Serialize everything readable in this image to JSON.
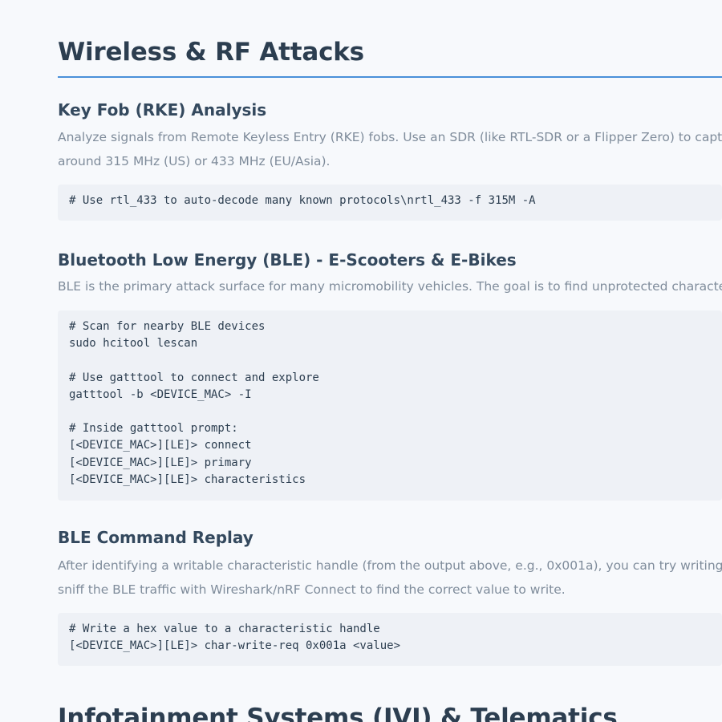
{
  "section": {
    "title": "Wireless & RF Attacks"
  },
  "rke": {
    "title": "Key Fob (RKE) Analysis",
    "line1": "Analyze signals from Remote Keyless Entry (RKE) fobs. Use an SDR (like RTL-SDR or a Flipper Zero) to capture t",
    "line2": "around 315 MHz (US) or 433 MHz (EU/Asia).",
    "code": "# Use rtl_433 to auto-decode many known protocols\\nrtl_433 -f 315M -A"
  },
  "ble": {
    "title": "Bluetooth Low Energy (BLE) - E-Scooters & E-Bikes",
    "line1": "BLE is the primary attack surface for many micromobility vehicles. The goal is to find unprotected characterist",
    "code": "# Scan for nearby BLE devices\nsudo hcitool lescan\n\n# Use gatttool to connect and explore\ngatttool -b <DEVICE_MAC> -I\n\n# Inside gatttool prompt:\n[<DEVICE_MAC>][LE]> connect\n[<DEVICE_MAC>][LE]> primary\n[<DEVICE_MAC>][LE]> characteristics"
  },
  "replay": {
    "title": "BLE Command Replay",
    "line1": "After identifying a writable characteristic handle (from the output above, e.g., 0x001a), you can try writing val",
    "line2": "sniff the BLE traffic with Wireshark/nRF Connect to find the correct value to write.",
    "code": "# Write a hex value to a characteristic handle\n[<DEVICE_MAC>][LE]> char-write-req 0x001a <value>"
  },
  "next_section": {
    "title": "Infotainment Systems (IVI) & Telematics"
  }
}
